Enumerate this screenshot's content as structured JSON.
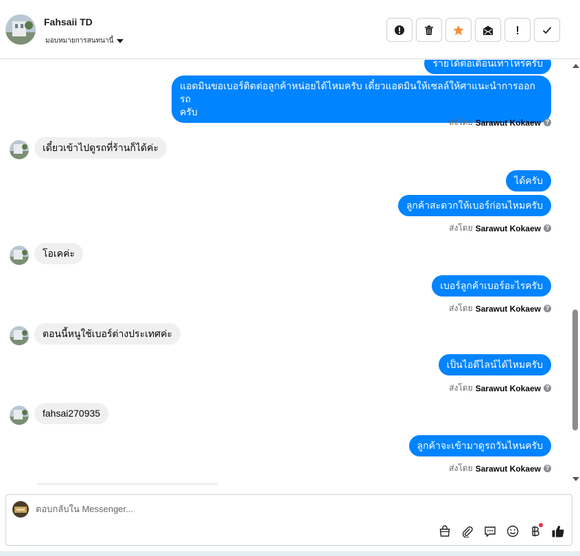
{
  "header": {
    "contact_name": "Fahsaii TD",
    "assign_label": "มอบหมายการสนทนานี้",
    "actions": [
      "spam-icon",
      "trash-icon",
      "star-icon",
      "mark-unread-icon",
      "follow-up-icon",
      "done-icon"
    ]
  },
  "messages": {
    "clipped_top_text": "รายได้ต่อเดือนเท่าไหร่ครับ",
    "m1_line1": "แอดมินขอเบอร์ติดต่อลูกค้าหน่อยได้ไหมครับ เดี๋ยวแอดมินให้เซลล์ให้ศาแนะนำการออกรถ",
    "m1_line2": "ครับ",
    "sent_prefix": "ส่งโดย",
    "agent_name": "Sarawut Kokaew",
    "help_glyph": "?",
    "in1": "เดี๋ยวเข้าไปดูรถที่ร้านก็ได้ค่ะ",
    "out2": "ได้ครับ",
    "out3": "ลูกค้าสะดวกให้เบอร์ก่อนไหมครับ",
    "in2": "โอเคค่ะ",
    "out4": "เบอร์ลูกค้าเบอร์อะไรครับ",
    "in3": "ตอนนี้หนูใช้เบอร์ต่างประเทศค่ะ",
    "out5": "เป็นไอดีไลน์ได้ไหมครับ",
    "in4": "fahsai270935",
    "out6": "ลูกค้าจะเข้ามาดูรถวันไหนครับ"
  },
  "composer": {
    "placeholder": "ตอบกลับใน Messenger...",
    "tools": [
      "shop-bag-icon",
      "attach-icon",
      "saved-reply-icon",
      "emoji-icon",
      "baht-icon",
      "like-icon"
    ]
  },
  "colors": {
    "accent": "#0084ff",
    "incoming": "#f0f0f0",
    "star": "#f7923a"
  }
}
